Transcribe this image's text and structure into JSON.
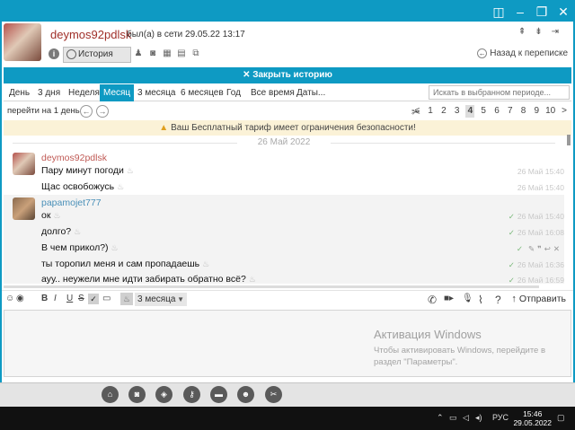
{
  "window": {
    "buttons": [
      "columns-icon",
      "minimize-icon",
      "maximize-icon",
      "close-icon"
    ]
  },
  "header": {
    "nickname": "deymos92pdlsk",
    "status": "был(а) в сети 29.05.22 13:17",
    "history_button": "История",
    "back_link": "Назад к переписке"
  },
  "close_history": "✕ Закрыть историю",
  "periods": [
    "День",
    "3 дня",
    "Неделя",
    "Месяц",
    "3 месяца",
    "6 месяцев",
    "Год",
    "Все время",
    "Даты..."
  ],
  "active_period": "Месяц",
  "search_placeholder": "Искать в выбранном периоде...",
  "goto_label": "перейти на 1 день",
  "pager": {
    "pages": [
      "1",
      "2",
      "3",
      "4",
      "5",
      "6",
      "7",
      "8",
      "9",
      "10"
    ],
    "current": "4"
  },
  "warning": "Ваш Бесплатный тариф имеет ограничения безопасности!",
  "date_separator": "26 Май 2022",
  "messages": [
    {
      "author": "deymos92pdlsk",
      "lines": [
        {
          "text": "Пару минут погоди",
          "time": "26 Май 15:40"
        },
        {
          "text": "Щас освобожусь",
          "time": "26 Май 15:40"
        }
      ]
    },
    {
      "author": "papamojet777",
      "lines": [
        {
          "text": "ок",
          "time": "26 Май 15:40"
        },
        {
          "text": "долго?",
          "time": "26 Май 16:08"
        },
        {
          "text": "В чем прикол?)",
          "time": ""
        },
        {
          "text": "ты торопил меня и сам пропадаешь",
          "time": "26 Май 16:36"
        },
        {
          "text": "ауу.. неужели мне идти забирать обратно всё?",
          "time": "26 Май 16:59"
        }
      ]
    }
  ],
  "format_bar": {
    "bold": "B",
    "italic": "I",
    "underline": "U",
    "strike": "S",
    "ttl": "3 месяца",
    "send": "Отправить"
  },
  "activation": {
    "title": "Активация Windows",
    "text": "Чтобы активировать Windows, перейдите в раздел \"Параметры\"."
  },
  "taskbar": {
    "lang": "РУС",
    "time": "15:46",
    "date": "29.05.2022"
  }
}
